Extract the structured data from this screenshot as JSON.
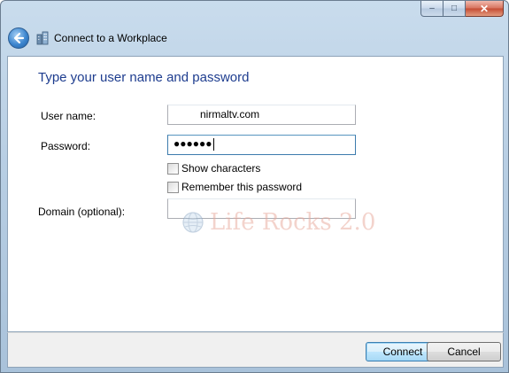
{
  "window": {
    "title": "Connect to a Workplace",
    "caption_buttons": {
      "minimize": "–",
      "maximize": "□",
      "close": "✕"
    }
  },
  "main": {
    "heading": "Type your user name and password",
    "username": {
      "label": "User name:",
      "value": "nirmaltv.com"
    },
    "password": {
      "label": "Password:",
      "masked_value": "●●●●●●"
    },
    "show_characters": {
      "label": "Show characters",
      "checked": false
    },
    "remember_password": {
      "label": "Remember this password",
      "checked": false
    },
    "domain": {
      "label": "Domain (optional):",
      "value": ""
    },
    "watermark": "Life Rocks 2.0"
  },
  "footer": {
    "connect_label": "Connect",
    "cancel_label": "Cancel"
  },
  "colors": {
    "heading": "#1e3d8f",
    "frame": "#b9cfe4",
    "close_button": "#c44b32"
  }
}
